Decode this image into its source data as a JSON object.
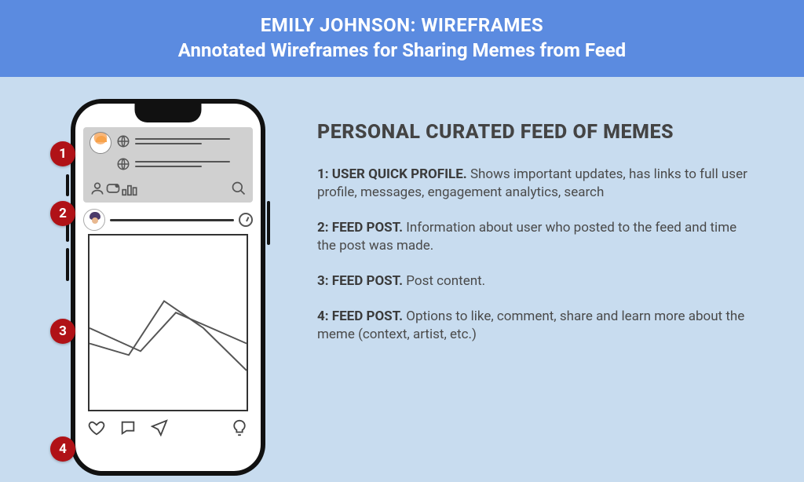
{
  "header": {
    "title": "EMILY JOHNSON: WIREFRAMES",
    "subtitle": "Annotated Wireframes for Sharing Memes from Feed"
  },
  "section_title": "PERSONAL CURATED FEED OF MEMES",
  "annotations": [
    {
      "num": "1",
      "label": "1: USER QUICK PROFILE.",
      "text": " Shows important updates, has links to full user profile, messages, engagement analytics, search"
    },
    {
      "num": "2",
      "label": "2: FEED POST.",
      "text": " Information about user who posted to the feed and time the post was made."
    },
    {
      "num": "3",
      "label": "3: FEED POST.",
      "text": " Post content."
    },
    {
      "num": "4",
      "label": "4: FEED POST.",
      "text": " Options to like, comment, share and learn more about the meme (context, artist, etc.)"
    }
  ]
}
